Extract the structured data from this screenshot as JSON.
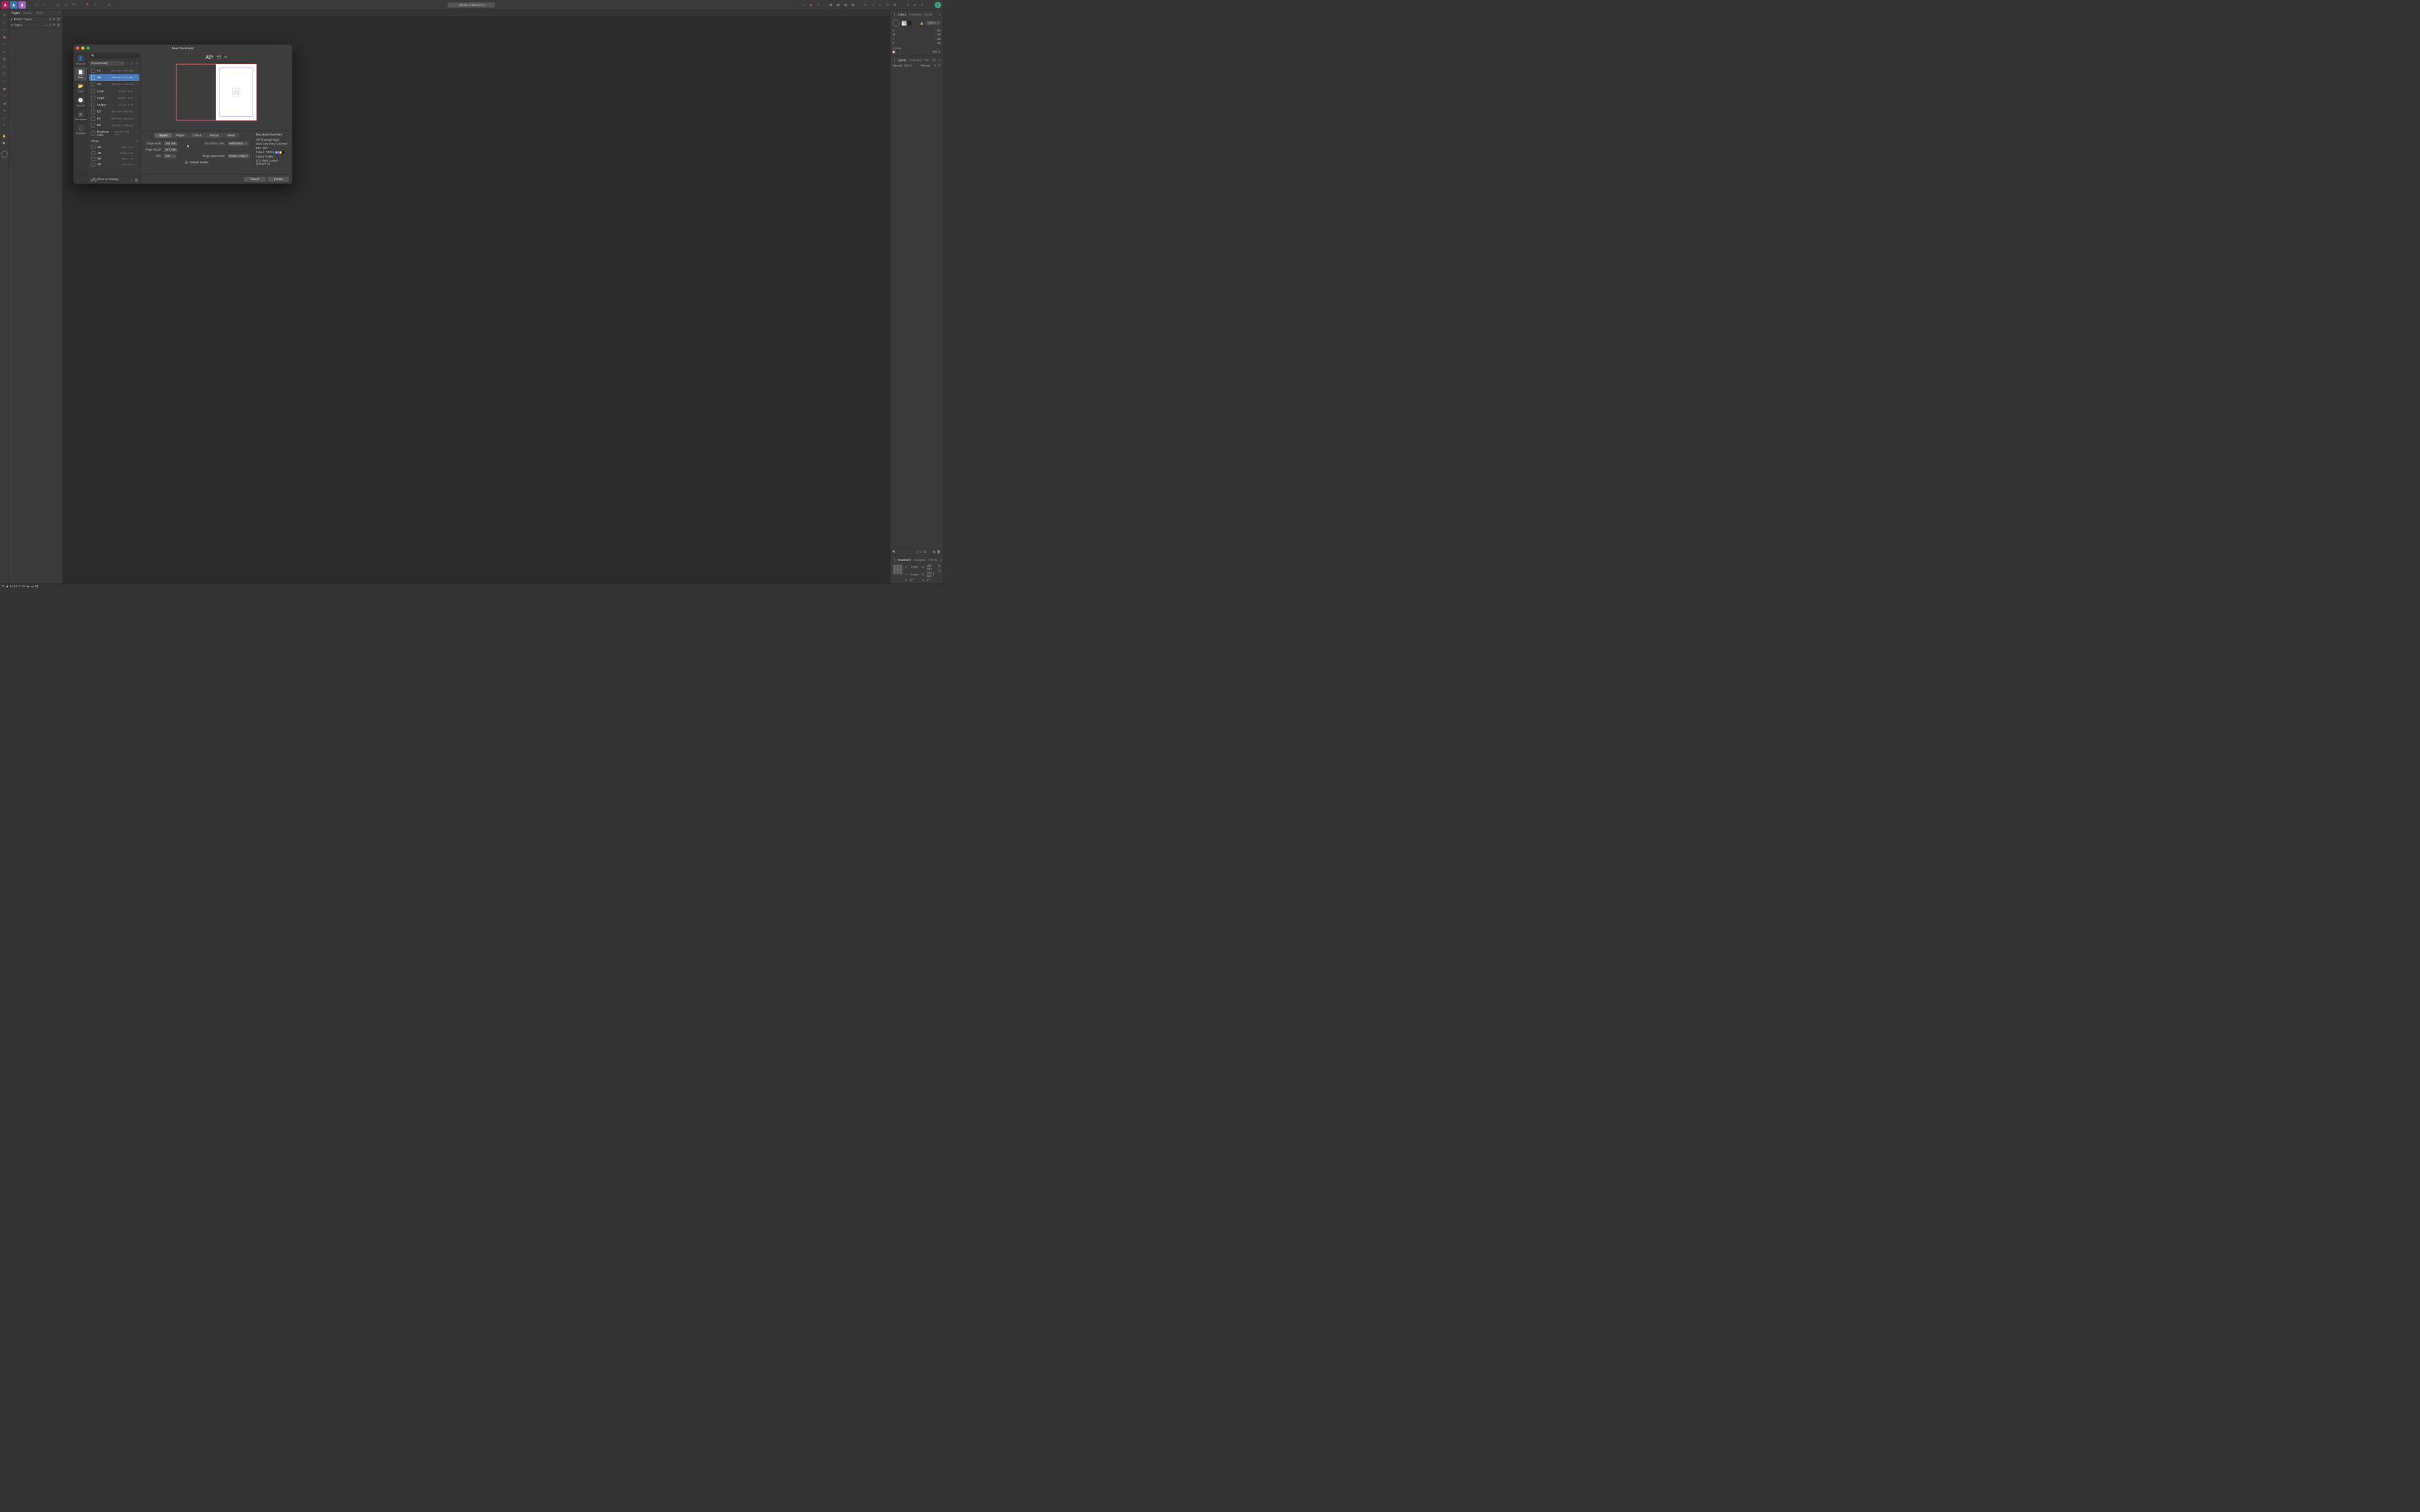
{
  "topbar": {
    "title": "Affinity Publisher 2"
  },
  "left_panel": {
    "tabs": [
      "Pages",
      "Assets",
      "Stock"
    ],
    "active_tab": 0,
    "sections": {
      "master": "Master Pages",
      "pages": "Pages"
    }
  },
  "right_panel": {
    "colour": {
      "tabs": [
        "Colour",
        "Swatches",
        "Stroke"
      ],
      "model_label": "CMYK",
      "channels": {
        "C": "82",
        "M": "96",
        "Y": "36",
        "K": "32"
      },
      "opacity_label": "Opacity",
      "opacity_value": "100 %"
    },
    "layers": {
      "tabs": [
        "Layers",
        "Character",
        "Par",
        "TSt"
      ],
      "opacity_label": "Opacity:",
      "opacity_value": "100 %",
      "blend": "Normal"
    },
    "transform": {
      "tabs": [
        "Transform",
        "Navigator",
        "History"
      ],
      "X_label": "X:",
      "X": "-3 mm",
      "Y_label": "Y:",
      "Y": "-3 mm",
      "W_label": "W:",
      "W": "260 mm",
      "H_label": "H:",
      "H": "206.1 mm",
      "R_label": "R:",
      "R": "0 °",
      "S_label": "S:",
      "S": "0 °"
    }
  },
  "statusbar": {
    "page_info": "12,13 of 124"
  },
  "dialog": {
    "title": "New Document",
    "search_placeholder": "",
    "categories": [
      {
        "label": "Account"
      },
      {
        "label": "New"
      },
      {
        "label": "Open"
      },
      {
        "label": "Recent"
      },
      {
        "label": "Templates"
      },
      {
        "label": "Samples"
      }
    ],
    "active_category": 1,
    "filter_label": "Press Ready",
    "presets_press": [
      {
        "name": "A4",
        "dim": "210 mm × 297 mm"
      },
      {
        "name": "A5",
        "dim": "148 mm × 210 mm"
      },
      {
        "name": "A6",
        "dim": "105 mm × 148 mm"
      },
      {
        "name": "Letter",
        "dim": "8.5 in × 11 in"
      },
      {
        "name": "Legal",
        "dim": "8.5 in × 14 in"
      },
      {
        "name": "Ledger",
        "dim": "11 in × 17 in"
      },
      {
        "name": "B3",
        "dim": "353 mm × 500 mm"
      },
      {
        "name": "B4",
        "dim": "250 mm × 353 mm"
      },
      {
        "name": "B5",
        "dim": "176 mm × 250 mm"
      },
      {
        "name": "Business Card",
        "dim": "55 mm × 88 mm"
      }
    ],
    "photo_header": "Photo",
    "presets_photo": [
      {
        "name": "4R",
        "dim": "4 in × 6 in"
      },
      {
        "name": "4D",
        "dim": "4.5 in × 6 in"
      },
      {
        "name": "5R",
        "dim": "5 in × 7 in"
      },
      {
        "name": "6R",
        "dim": "6 in × 8 in"
      }
    ],
    "selected_preset": 1,
    "preview_title": "A5*",
    "setting_tabs": [
      "Layout",
      "Pages",
      "Colour",
      "Margin",
      "Bleed"
    ],
    "active_setting_tab": 0,
    "settings": {
      "page_width_label": "Page width:",
      "page_width": "148 mm",
      "page_height_label": "Page height:",
      "page_height": "210 mm",
      "dpi_label": "DPI:",
      "dpi": "300",
      "doc_units_label": "Document units:",
      "doc_units": "Millimetres",
      "image_placement_label": "Image placement:",
      "image_placement": "Prefer Linked",
      "default_master_label": "Default master"
    },
    "summary": {
      "title": "Document Summary",
      "preset_name": "A5* (Facing Page)",
      "size_label": "Size:",
      "size": "148 mm x 210 mm",
      "dpi_label": "DPI:",
      "dpi": "300",
      "colour_label": "Colour:",
      "colour": "CMYK",
      "profile_label": "Colour Profile:",
      "profile": "U.S. Web Coated (SWOP) v2"
    },
    "show_startup": "Show on Startup",
    "cancel": "Cancel",
    "create": "Create"
  }
}
